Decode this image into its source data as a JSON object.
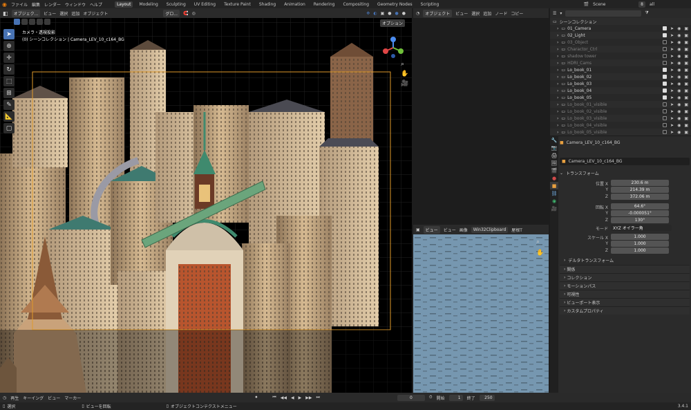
{
  "top_menu": [
    "ファイル",
    "編集",
    "レンダー",
    "ウィンドウ",
    "ヘルプ"
  ],
  "workspaces": [
    "Layout",
    "Modeling",
    "Sculpting",
    "UV Editing",
    "Texture Paint",
    "Shading",
    "Animation",
    "Rendering",
    "Compositing",
    "Geometry Nodes",
    "Scripting"
  ],
  "active_workspace": "Layout",
  "scene": {
    "name": "Scene",
    "view_layer": "all",
    "frame_index": "8"
  },
  "viewport": {
    "mode": "オブジェク...",
    "menus": [
      "ビュー",
      "選択",
      "追加",
      "オブジェクト"
    ],
    "transform": "グロ...",
    "options": "オプション",
    "overlay_title": "カメラ・透視投影",
    "overlay_sub": "(0) シーンコレクション | Camera_LEV_10_c164_BG"
  },
  "node_editor": {
    "mode": "オブジェクト",
    "menus": [
      "ビュー",
      "選択",
      "追加",
      "ノード",
      "コピー"
    ]
  },
  "image_editor": {
    "menus": [
      "ビュー",
      "ビュー",
      "画像"
    ],
    "image_name": "Win32Clipboard",
    "extra": "屋根T"
  },
  "outliner": {
    "root": "シーンコレクション",
    "rows": [
      {
        "name": "01_Camera",
        "dim": false,
        "vis": true
      },
      {
        "name": "02_Light",
        "dim": false,
        "vis": true
      },
      {
        "name": "03_Object",
        "dim": true,
        "vis": false
      },
      {
        "name": "Charactor_Ctrl",
        "dim": true,
        "vis": false
      },
      {
        "name": "shadow tower",
        "dim": true,
        "vis": false
      },
      {
        "name": "HDRI_Cams",
        "dim": true,
        "vis": false
      },
      {
        "name": "Lo_book_01",
        "dim": false,
        "vis": true
      },
      {
        "name": "Lo_book_02",
        "dim": false,
        "vis": true
      },
      {
        "name": "Lo_book_03",
        "dim": false,
        "vis": true
      },
      {
        "name": "Lo_book_04",
        "dim": false,
        "vis": true
      },
      {
        "name": "Lo_book_05",
        "dim": false,
        "vis": true
      },
      {
        "name": "Lo_book_01_visible",
        "dim": true,
        "vis": false
      },
      {
        "name": "Lo_book_02_visible",
        "dim": true,
        "vis": false
      },
      {
        "name": "Lo_book_03_visible",
        "dim": true,
        "vis": false
      },
      {
        "name": "Lo_book_04_visible",
        "dim": true,
        "vis": false
      },
      {
        "name": "Lo_book_05_visible",
        "dim": true,
        "vis": false
      }
    ]
  },
  "properties": {
    "object_name": "Camera_LEV_10_c164_BG",
    "data_name": "Camera_LEV_10_c164_BG",
    "transform_title": "トランスフォーム",
    "location_label": "位置 X",
    "y": "Y",
    "z": "Z",
    "location": [
      "230.6 m",
      "214.39 m",
      "372.06 m"
    ],
    "rotation_label": "回転 X",
    "rotation": [
      "64.6°",
      "-0.000051°",
      "130°"
    ],
    "mode_label": "モード",
    "mode_value": "XYZ オイラー角",
    "scale_label": "スケール X",
    "scale": [
      "1.000",
      "1.000",
      "1.000"
    ],
    "delta": "デルタトランスフォーム",
    "sections": [
      "関係",
      "コレクション",
      "モーションパス",
      "可視性",
      "ビューポート表示",
      "カスタムプロパティ"
    ]
  },
  "timeline": {
    "menus": [
      "再生",
      "キーイング",
      "ビュー",
      "マーカー"
    ],
    "current_frame": "0",
    "start_label": "開始",
    "start": "1",
    "end_label": "終了",
    "end": "250"
  },
  "status_bar": {
    "select": "選択",
    "rotate": "ビューを回転",
    "context": "オブジェクトコンテクストメニュー",
    "version": "3.4.1"
  },
  "colors": {
    "accent": "#4772b3",
    "sky": "#000000",
    "building": "#c9ab84",
    "roof_teal": "#3f7a70",
    "brick": "#b8552e",
    "water": "#6a8da8"
  },
  "icons": [
    "blender-logo-icon",
    "select-box-icon",
    "cursor-icon",
    "move-icon",
    "rotate-icon",
    "scale-icon",
    "transform-icon",
    "annotate-icon",
    "measure-icon",
    "add-cube-icon",
    "zoom-icon",
    "hand-icon",
    "camera-icon",
    "navigation-gizmo-icon"
  ]
}
